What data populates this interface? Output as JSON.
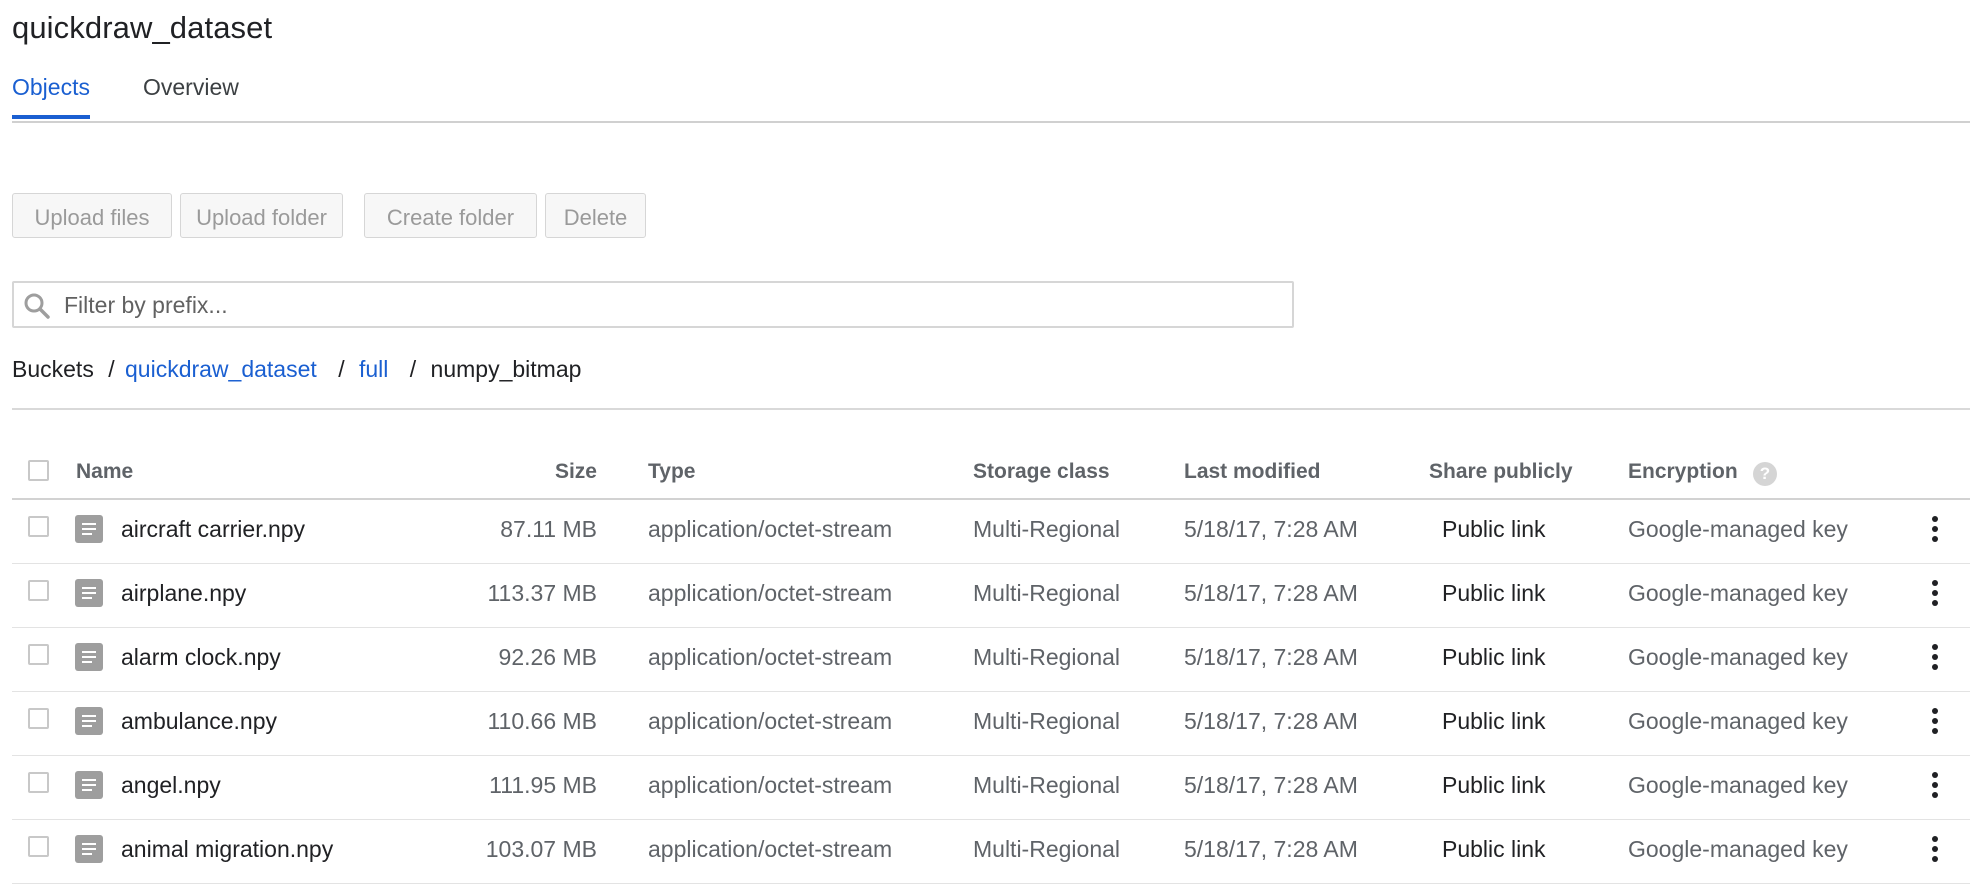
{
  "page": {
    "title": "quickdraw_dataset"
  },
  "tabs": [
    {
      "label": "Objects",
      "active": true
    },
    {
      "label": "Overview",
      "active": false
    }
  ],
  "toolbar": {
    "upload_files": "Upload files",
    "upload_folder": "Upload folder",
    "create_folder": "Create folder",
    "delete": "Delete"
  },
  "filter": {
    "placeholder": "Filter by prefix...",
    "value": "",
    "icon": "search-icon"
  },
  "breadcrumb": {
    "root": "Buckets",
    "bucket": "quickdraw_dataset",
    "folder": "full",
    "current": "numpy_bitmap",
    "separator": "/"
  },
  "table": {
    "columns": {
      "name": "Name",
      "size": "Size",
      "type": "Type",
      "storage_class": "Storage class",
      "last_modified": "Last modified",
      "share_publicly": "Share publicly",
      "encryption": "Encryption"
    },
    "help_glyph": "?",
    "rows": [
      {
        "name": "aircraft carrier.npy",
        "size": "87.11 MB",
        "type": "application/octet-stream",
        "storage_class": "Multi-Regional",
        "last_modified": "5/18/17, 7:28 AM",
        "share": "Public link",
        "encryption": "Google-managed key"
      },
      {
        "name": "airplane.npy",
        "size": "113.37 MB",
        "type": "application/octet-stream",
        "storage_class": "Multi-Regional",
        "last_modified": "5/18/17, 7:28 AM",
        "share": "Public link",
        "encryption": "Google-managed key"
      },
      {
        "name": "alarm clock.npy",
        "size": "92.26 MB",
        "type": "application/octet-stream",
        "storage_class": "Multi-Regional",
        "last_modified": "5/18/17, 7:28 AM",
        "share": "Public link",
        "encryption": "Google-managed key"
      },
      {
        "name": "ambulance.npy",
        "size": "110.66 MB",
        "type": "application/octet-stream",
        "storage_class": "Multi-Regional",
        "last_modified": "5/18/17, 7:28 AM",
        "share": "Public link",
        "encryption": "Google-managed key"
      },
      {
        "name": "angel.npy",
        "size": "111.95 MB",
        "type": "application/octet-stream",
        "storage_class": "Multi-Regional",
        "last_modified": "5/18/17, 7:28 AM",
        "share": "Public link",
        "encryption": "Google-managed key"
      },
      {
        "name": "animal migration.npy",
        "size": "103.07 MB",
        "type": "application/octet-stream",
        "storage_class": "Multi-Regional",
        "last_modified": "5/18/17, 7:28 AM",
        "share": "Public link",
        "encryption": "Google-managed key"
      }
    ]
  },
  "colors": {
    "accent": "#1a5fd1",
    "text": "#202124",
    "muted": "#5f6368",
    "border": "#d6d6d6"
  }
}
